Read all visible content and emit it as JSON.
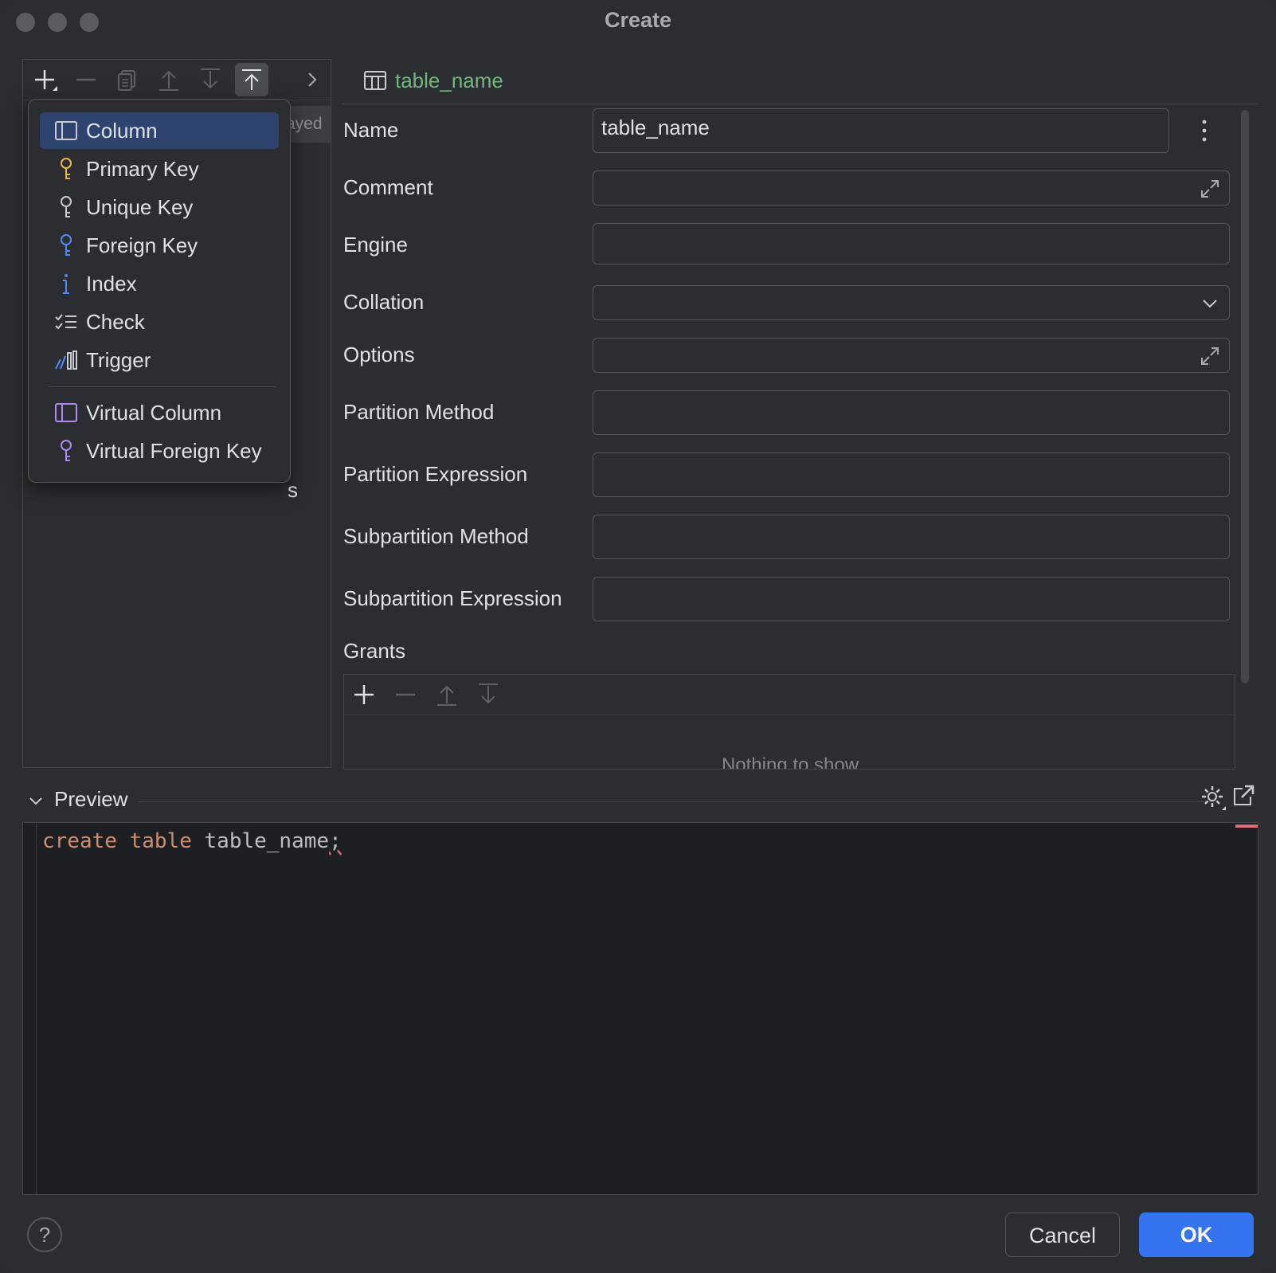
{
  "window": {
    "title": "Create"
  },
  "left_panel": {
    "background_tab_text": "ayed",
    "background_text_s": "s"
  },
  "add_menu": {
    "items": [
      {
        "label": "Column",
        "icon": "column-icon",
        "selected": true
      },
      {
        "label": "Primary Key",
        "icon": "primary-key-icon"
      },
      {
        "label": "Unique Key",
        "icon": "unique-key-icon"
      },
      {
        "label": "Foreign Key",
        "icon": "foreign-key-icon"
      },
      {
        "label": "Index",
        "icon": "index-icon"
      },
      {
        "label": "Check",
        "icon": "check-icon"
      },
      {
        "label": "Trigger",
        "icon": "trigger-icon"
      }
    ],
    "virtual_items": [
      {
        "label": "Virtual Column",
        "icon": "virtual-column-icon"
      },
      {
        "label": "Virtual Foreign Key",
        "icon": "virtual-foreign-key-icon"
      }
    ]
  },
  "tab": {
    "label": "table_name",
    "icon": "table-icon"
  },
  "form": {
    "name": {
      "label": "Name",
      "value": "table_name"
    },
    "comment": {
      "label": "Comment",
      "value": ""
    },
    "engine": {
      "label": "Engine",
      "value": ""
    },
    "collation": {
      "label": "Collation",
      "value": ""
    },
    "options": {
      "label": "Options",
      "value": ""
    },
    "partition_method": {
      "label": "Partition Method",
      "value": ""
    },
    "partition_expression": {
      "label": "Partition Expression",
      "value": ""
    },
    "subpartition_method": {
      "label": "Subpartition Method",
      "value": ""
    },
    "subpartition_expression": {
      "label": "Subpartition Expression",
      "value": ""
    }
  },
  "grants": {
    "label": "Grants",
    "empty_text": "Nothing to show"
  },
  "preview": {
    "label": "Preview",
    "code": {
      "kw1": "create",
      "kw2": "table",
      "ident": "table_name",
      "semi": ";"
    }
  },
  "buttons": {
    "help": "?",
    "cancel": "Cancel",
    "ok": "OK"
  },
  "colors": {
    "accent": "#3574f0",
    "tab_label": "#6fba7a",
    "keyword": "#cf8e6d",
    "selection": "#2e436e"
  }
}
